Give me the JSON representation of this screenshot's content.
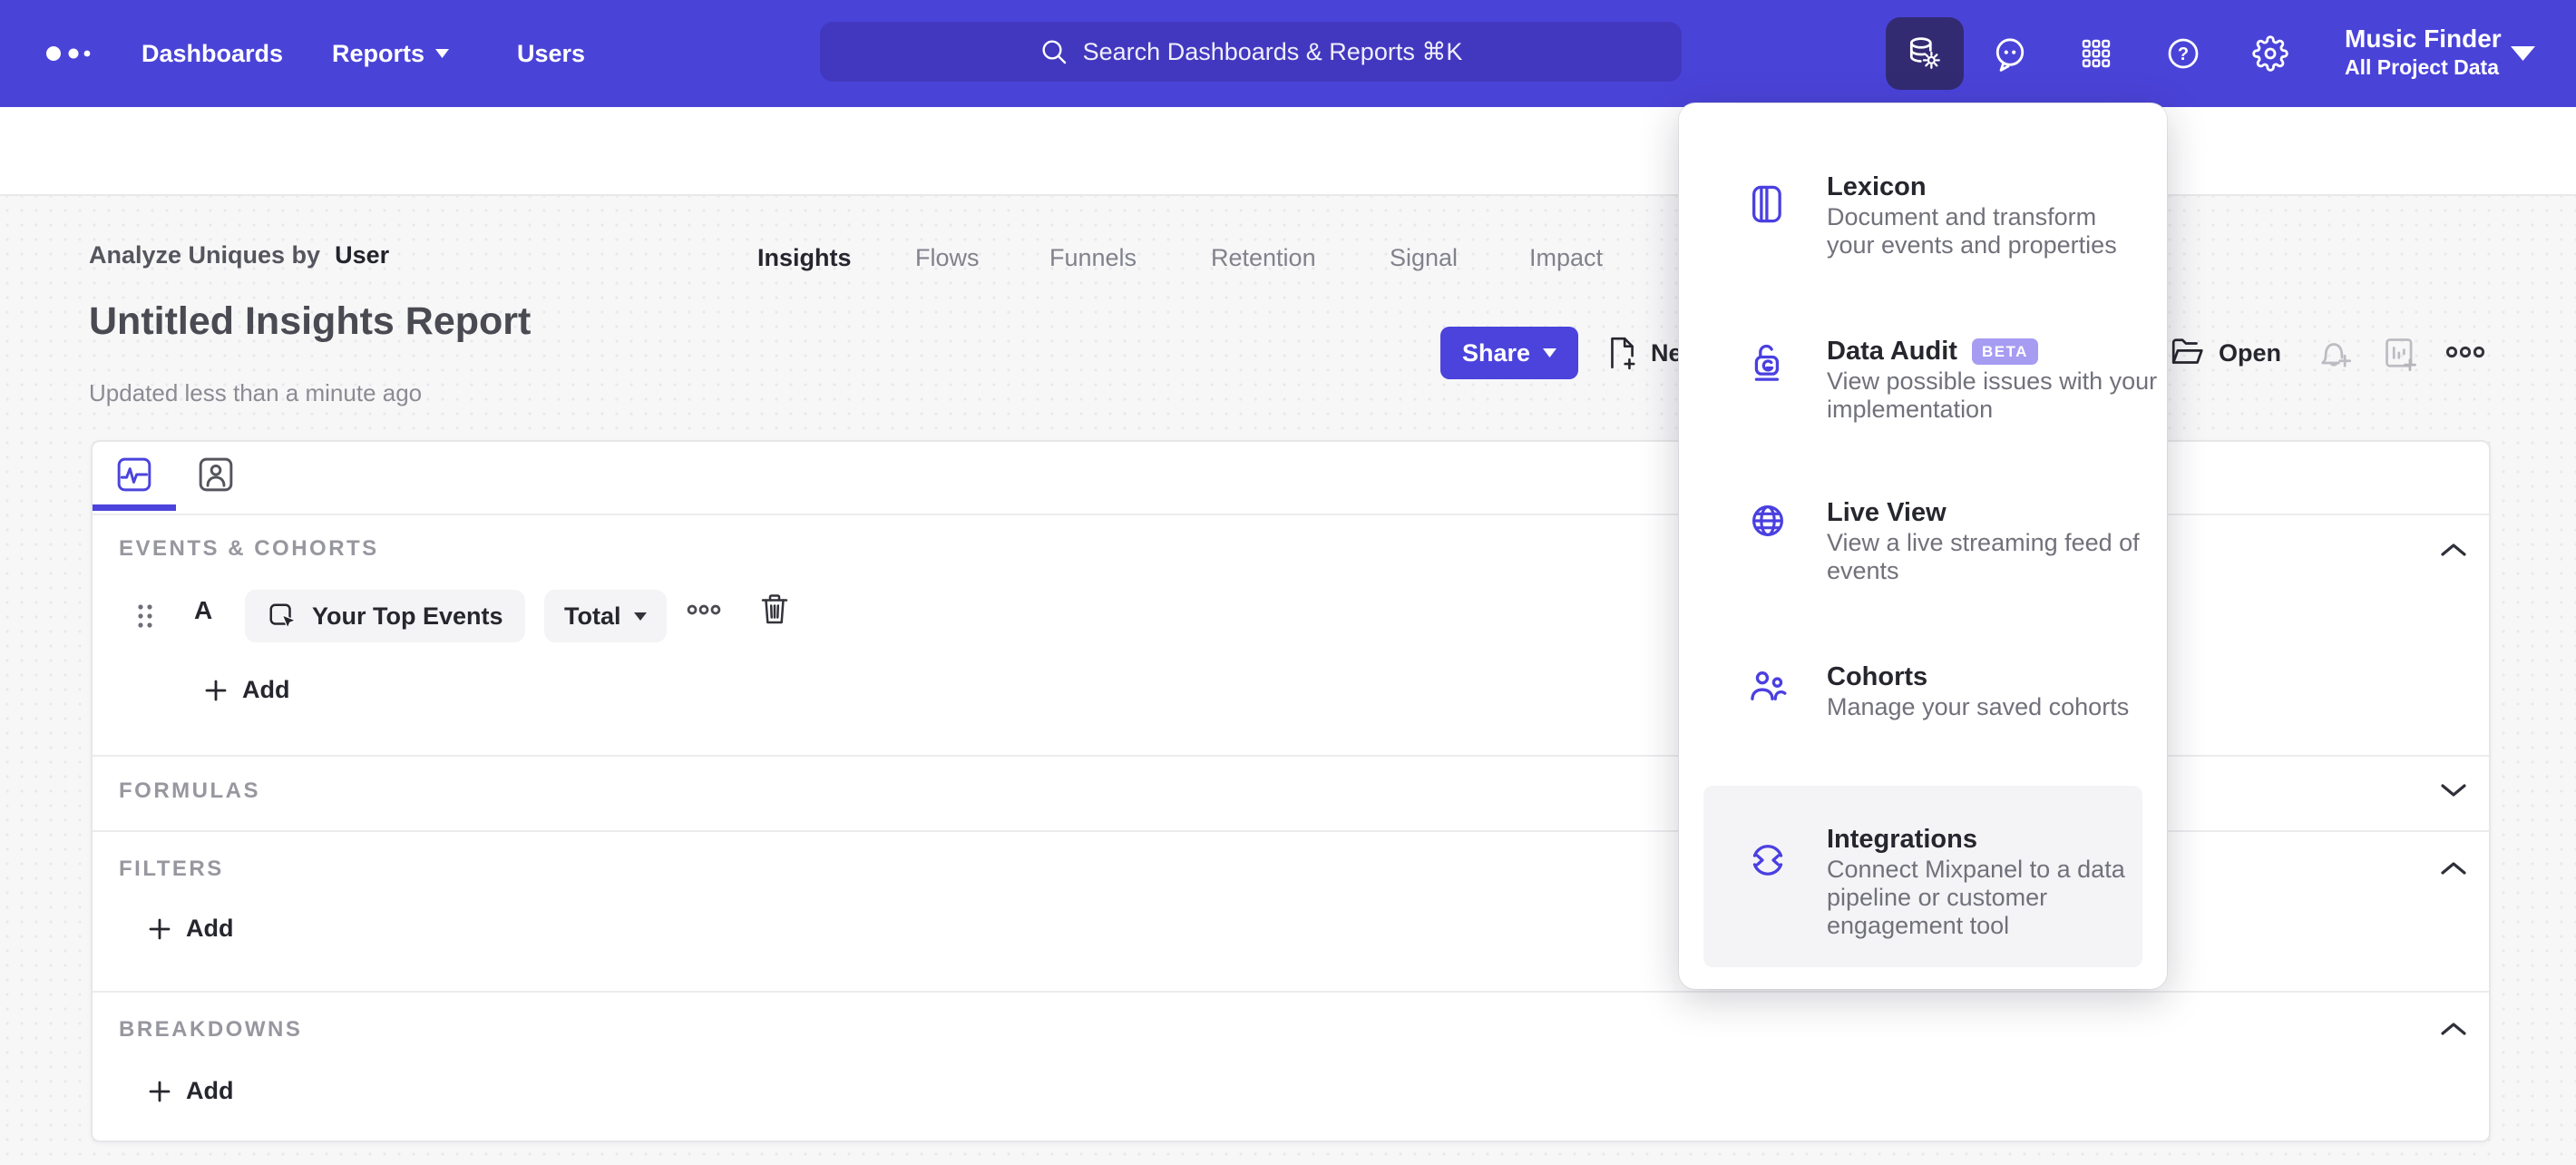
{
  "colors": {
    "nav_background": "#4A43D8",
    "search_background": "#4238BF",
    "active_tool_background": "#322B72",
    "accent_purple": "#4B43DC",
    "menu_icon_purple": "#4A3FE0",
    "beta_badge": "#A69CF2",
    "page_background": "#F7F7F8",
    "text_dark": "#26262E",
    "text_gray": "#71717B",
    "section_label_gray": "#97979F",
    "disabled_icon_gray": "#BCBCC2"
  },
  "nav": {
    "items": [
      {
        "label": "Dashboards"
      },
      {
        "label": "Reports"
      },
      {
        "label": "Users"
      }
    ],
    "search": {
      "placeholder": "Search Dashboards & Reports ⌘K"
    },
    "project": {
      "name": "Music Finder",
      "scope": "All Project Data"
    }
  },
  "tabs": [
    {
      "label": "Insights"
    },
    {
      "label": "Flows"
    },
    {
      "label": "Funnels"
    },
    {
      "label": "Retention"
    },
    {
      "label": "Signal"
    },
    {
      "label": "Impact"
    }
  ],
  "report": {
    "analyze_by_label": "Analyze Uniques by",
    "analyze_by_value": "User",
    "title": "Untitled Insights Report",
    "updated": "Updated less than a minute ago"
  },
  "toolbar": {
    "share_label": "Share",
    "new_label": "New",
    "open_label": "Open"
  },
  "builder": {
    "events_section_label": "EVENTS & COHORTS",
    "event_row": {
      "letter": "A",
      "event_name": "Your Top Events",
      "aggregation": "Total"
    },
    "events_add_label": "Add",
    "formulas_section_label": "FORMULAS",
    "filters_section_label": "FILTERS",
    "filters_add_label": "Add",
    "breakdowns_section_label": "BREAKDOWNS",
    "breakdowns_add_label": "Add"
  },
  "menu": {
    "items": [
      {
        "title": "Lexicon",
        "description": "Document and transform your events and properties"
      },
      {
        "title": "Data Audit",
        "badge": "BETA",
        "description": "View possible issues with your implementation"
      },
      {
        "title": "Live View",
        "description": "View a live streaming feed of events"
      },
      {
        "title": "Cohorts",
        "description": "Manage your saved cohorts"
      },
      {
        "title": "Integrations",
        "description": "Connect Mixpanel to a data pipeline or customer engagement tool"
      }
    ]
  }
}
